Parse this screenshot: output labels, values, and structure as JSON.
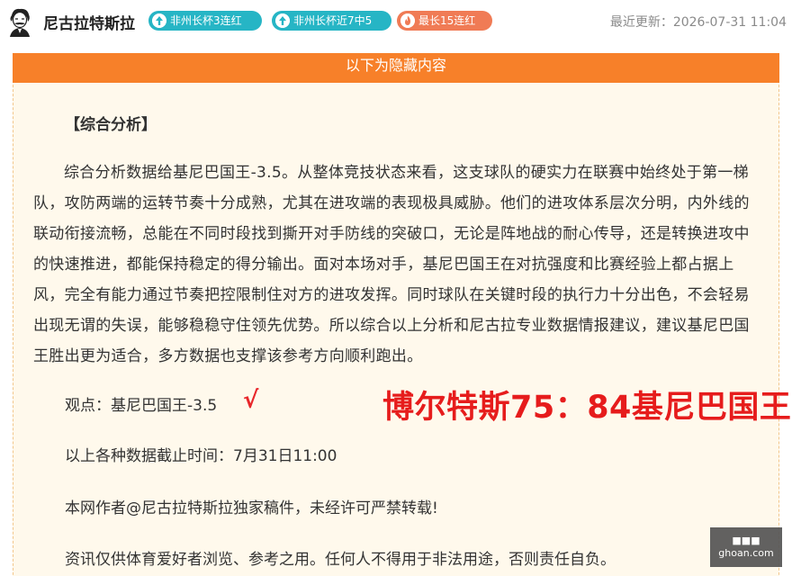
{
  "header": {
    "author_name": "尼古拉特斯拉",
    "badges": [
      {
        "label": "非州长杯3连红",
        "color": "#26b5c5",
        "icon": "up-arrow-icon"
      },
      {
        "label": "非州长杯近7中5",
        "color": "#26b5c5",
        "icon": "up-arrow-icon"
      },
      {
        "label": "最长15连红",
        "color": "#f07b55",
        "icon": "fire-icon"
      }
    ],
    "update_time": "最近更新：2026-07-31 11:04"
  },
  "content": {
    "hidden_banner": "以下为隐藏内容",
    "section_title": "【综合分析】",
    "paragraph": "综合分析数据给基尼巴国王-3.5。从整体竞技状态来看，这支球队的硬实力在联赛中始终处于第一梯队，攻防两端的运转节奏十分成熟，尤其在进攻端的表现极具威胁。他们的进攻体系层次分明，内外线的联动衔接流畅，总能在不同时段找到撕开对手防线的突破口，无论是阵地战的耐心传导，还是转换进攻中的快速推进，都能保持稳定的得分输出。面对本场对手，基尼巴国王在对抗强度和比赛经验上都占据上风，完全有能力通过节奏把控限制住对方的进攻发挥。同时球队在关键时段的执行力十分出色，不会轻易出现无谓的失误，能够稳稳守住领先优势。所以综合以上分析和尼古拉专业数据情报建议，建议基尼巴国王胜出更为适合，多方数据也支撑该参考方向顺利跑出。",
    "viewpoint": "观点：基尼巴国王-3.5",
    "check_mark": "√",
    "score": "博尔特斯75：84基尼巴国王",
    "deadline": "以上各种数据截止时间：7月31日11:00",
    "copyright": "本网作者@尼古拉特斯拉独家稿件，未经许可严禁转载!",
    "disclaimer": "资讯仅供体育爱好者浏览、参考之用。任何人不得用于非法用途，否则责任自负。"
  },
  "watermark": {
    "line1": "■■■",
    "line2": "ghoan.com"
  },
  "colors": {
    "banner": "#f78029",
    "badge_teal": "#26b5c5",
    "badge_orange": "#f07b55",
    "score_red": "#e61c1c",
    "content_bg": "#fff9ec"
  }
}
